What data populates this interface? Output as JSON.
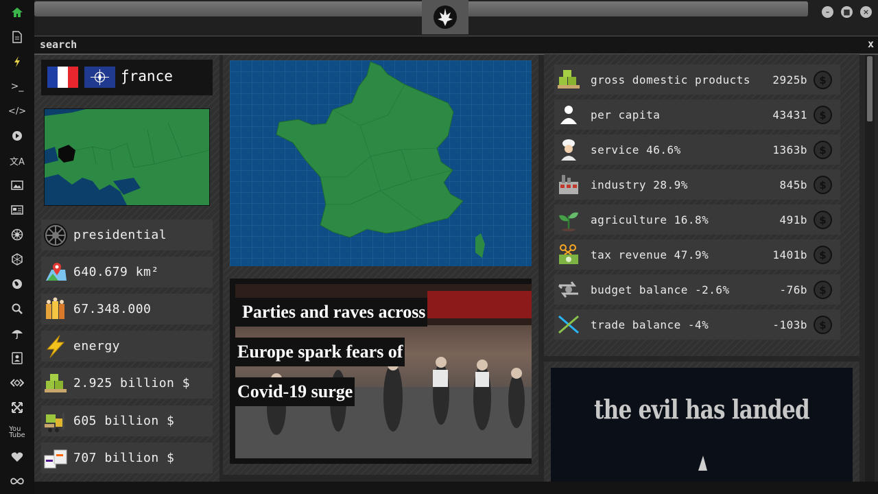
{
  "search": {
    "label": "search",
    "close": "x"
  },
  "country": {
    "name": "ƒrance"
  },
  "stats": [
    {
      "icon": "imperial-emblem-icon",
      "text": "presidential"
    },
    {
      "icon": "map-pin-icon",
      "text": "640.679 km²"
    },
    {
      "icon": "population-icon",
      "text": "67.348.000"
    },
    {
      "icon": "lightning-icon",
      "text": "energy"
    },
    {
      "icon": "gdp-pallet-icon",
      "text": "2.925 billion $"
    },
    {
      "icon": "forklift-icon",
      "text": "605 billion $"
    },
    {
      "icon": "fedex-boxes-icon",
      "text": "707 billion $"
    }
  ],
  "news": {
    "headline_lines": [
      "Parties and raves across",
      "Europe spark fears of",
      "Covid-19 surge"
    ]
  },
  "economy": [
    {
      "icon": "gdp-pallet-icon",
      "label": "gross domestic products",
      "value": "2925b"
    },
    {
      "icon": "person-icon",
      "label": "per capita",
      "value": "43431"
    },
    {
      "icon": "chef-icon",
      "label": "service 46.6%",
      "value": "1363b"
    },
    {
      "icon": "factory-icon",
      "label": "industry 28.9%",
      "value": "845b"
    },
    {
      "icon": "plant-icon",
      "label": "agriculture 16.8%",
      "value": "491b"
    },
    {
      "icon": "tax-money-icon",
      "label": "tax revenue 47.9%",
      "value": "1401b"
    },
    {
      "icon": "balance-arrows-icon",
      "label": "budget balance -2.6%",
      "value": "-76b"
    },
    {
      "icon": "trade-cross-icon",
      "label": "trade balance -4%",
      "value": "-103b"
    }
  ],
  "dollar_symbol": "$",
  "ad": {
    "text": "the evil has landed"
  },
  "colors": {
    "sidebar_active": "#39b54a",
    "sea": "#0f4d86",
    "land": "#2c8a44",
    "panel": "#303030"
  }
}
